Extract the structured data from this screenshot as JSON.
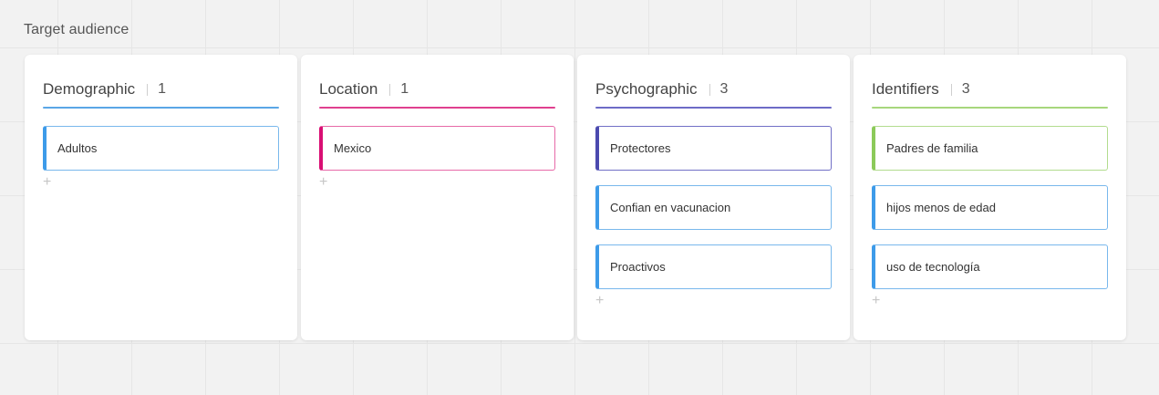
{
  "board": {
    "title": "Target audience"
  },
  "columns": [
    {
      "title": "Demographic",
      "count": "1",
      "accent": "#5aa6e6",
      "cards": [
        {
          "text": "Adultos",
          "border": "#79b8ec",
          "stripe": "#3d9be9"
        }
      ]
    },
    {
      "title": "Location",
      "count": "1",
      "accent": "#e0408f",
      "cards": [
        {
          "text": "Mexico",
          "border": "#e76aa8",
          "stripe": "#d90f74"
        }
      ]
    },
    {
      "title": "Psychographic",
      "count": "3",
      "accent": "#6d6bc7",
      "cards": [
        {
          "text": "Protectores",
          "border": "#7270c6",
          "stripe": "#4b4aaf"
        },
        {
          "text": "Confian en vacunacion",
          "border": "#79b8ec",
          "stripe": "#3d9be9"
        },
        {
          "text": "Proactivos",
          "border": "#79b8ec",
          "stripe": "#3d9be9"
        }
      ]
    },
    {
      "title": "Identifiers",
      "count": "3",
      "accent": "#a7d77c",
      "cards": [
        {
          "text": "Padres de familia",
          "border": "#b2dc8e",
          "stripe": "#8cca5a"
        },
        {
          "text": "hijos menos de edad",
          "border": "#79b8ec",
          "stripe": "#3d9be9"
        },
        {
          "text": "uso de tecnología",
          "border": "#79b8ec",
          "stripe": "#3d9be9"
        }
      ]
    }
  ],
  "icons": {
    "add": "+"
  }
}
